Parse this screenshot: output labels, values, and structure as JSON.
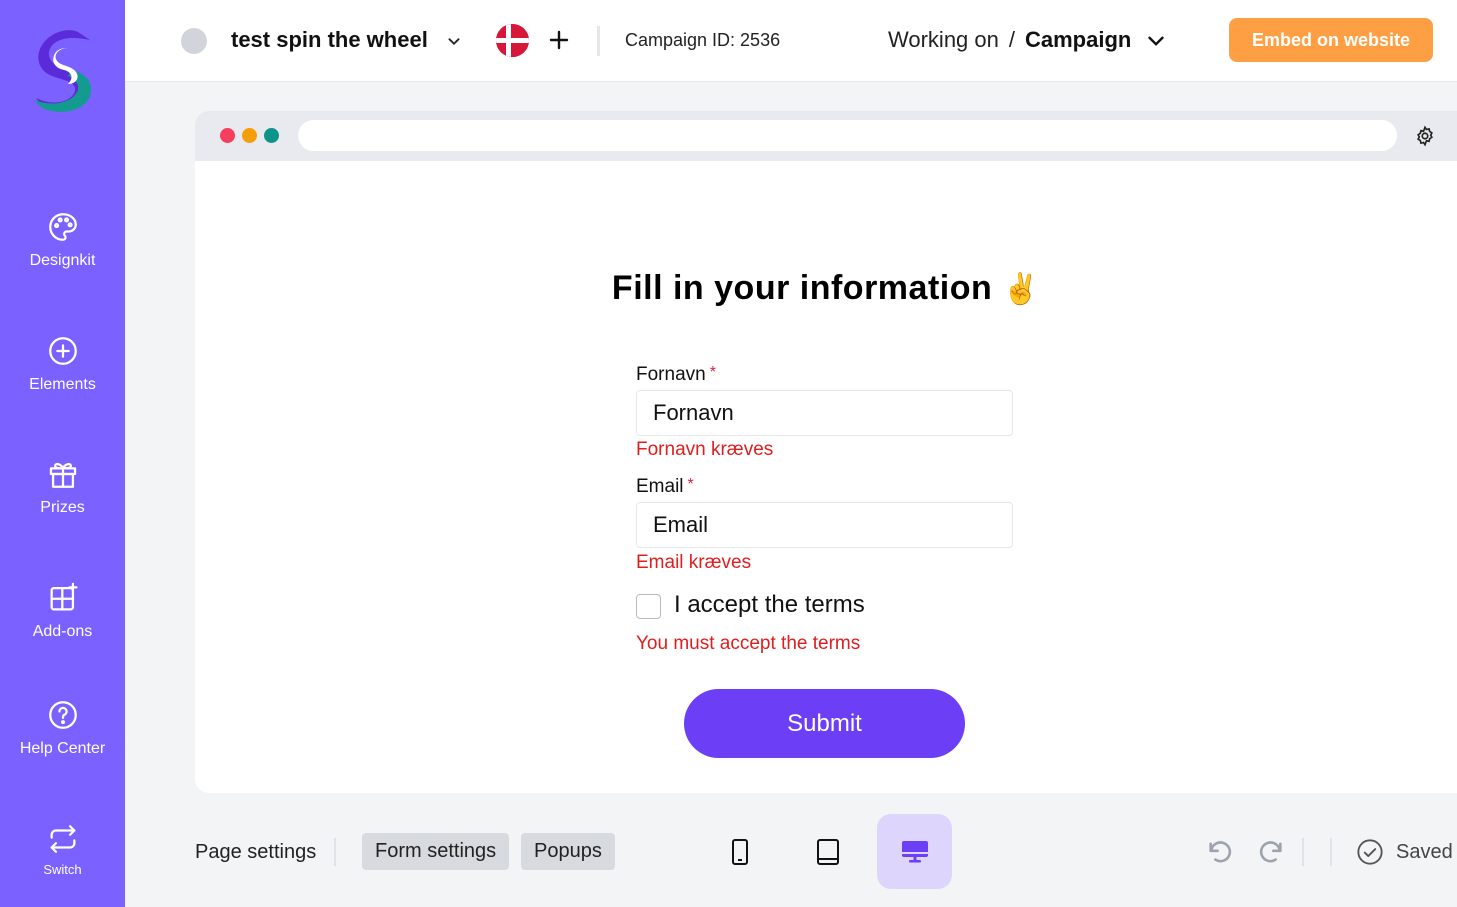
{
  "sidebar": {
    "items": [
      {
        "label": "Designkit",
        "icon": "palette-icon"
      },
      {
        "label": "Elements",
        "icon": "plus-circle-icon"
      },
      {
        "label": "Prizes",
        "icon": "gift-icon"
      },
      {
        "label": "Add-ons",
        "icon": "grid-plus-icon"
      },
      {
        "label": "Help Center",
        "icon": "help-circle-icon"
      },
      {
        "label": "Switch",
        "icon": "switch-arrows-icon"
      }
    ]
  },
  "header": {
    "campaign_name": "test spin the wheel",
    "campaign_id": "Campaign ID: 2536",
    "working_on": "Working on",
    "separator": "/",
    "context": "Campaign",
    "embed_label": "Embed on website"
  },
  "form": {
    "title": "Fill in your information",
    "emoji": "✌️",
    "fields": [
      {
        "label": "Fornavn",
        "required_mark": "*",
        "value": "Fornavn",
        "error": "Fornavn kræves"
      },
      {
        "label": "Email",
        "required_mark": "*",
        "value": "Email",
        "error": "Email kræves"
      }
    ],
    "terms_label": "I accept the terms",
    "terms_error": "You must accept the terms",
    "submit_label": "Submit"
  },
  "toolbar": {
    "page_settings": "Page settings",
    "form_settings": "Form settings",
    "popups": "Popups",
    "saved": "Saved"
  },
  "colors": {
    "sidebar": "#7b61ff",
    "accent": "#6c3ff7",
    "embed": "#ff9f43",
    "error": "#e11d1d"
  }
}
